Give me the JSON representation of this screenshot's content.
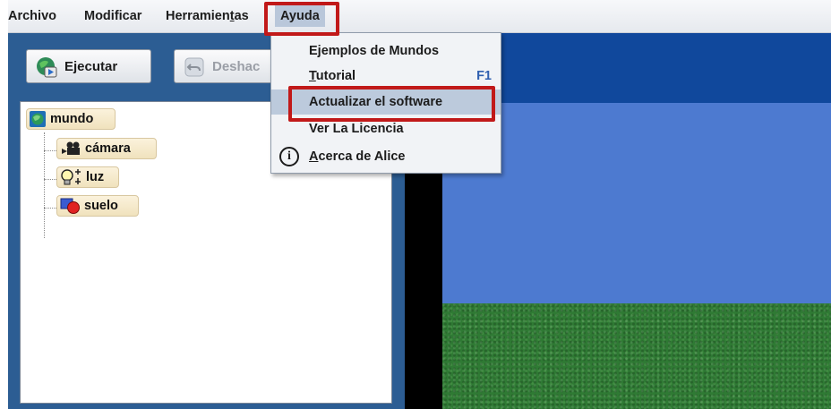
{
  "menubar": {
    "items": [
      {
        "label_pre": "Archivo",
        "label_mn": "",
        "label_post": ""
      },
      {
        "label_pre": "Modificar",
        "label_mn": "",
        "label_post": ""
      },
      {
        "label_pre": "Herramien",
        "label_mn": "t",
        "label_post": "as"
      },
      {
        "label_pre": "Ayuda",
        "label_mn": "",
        "label_post": ""
      }
    ]
  },
  "toolbar": {
    "run_label": "Ejecutar",
    "undo_label": "Deshac"
  },
  "tree": {
    "root": "mundo",
    "children": [
      "cámara",
      "luz",
      "suelo"
    ]
  },
  "help_menu": {
    "items": [
      {
        "label": "Ejemplos de Mundos",
        "accel": ""
      },
      {
        "label_mn": "T",
        "label_rest": "utorial",
        "accel": "F1"
      },
      {
        "label": "Actualizar el software",
        "accel": ""
      },
      {
        "label": "Ver La Licencia",
        "accel": ""
      },
      {
        "label_mn": "A",
        "label_rest": "cerca de Alice",
        "accel": "",
        "icon": "info-icon"
      }
    ]
  },
  "colors": {
    "highlight_red": "#c11919",
    "panel_blue": "#2c5d93",
    "sky": "#4d7ad0",
    "grass": "#2f7a34"
  }
}
